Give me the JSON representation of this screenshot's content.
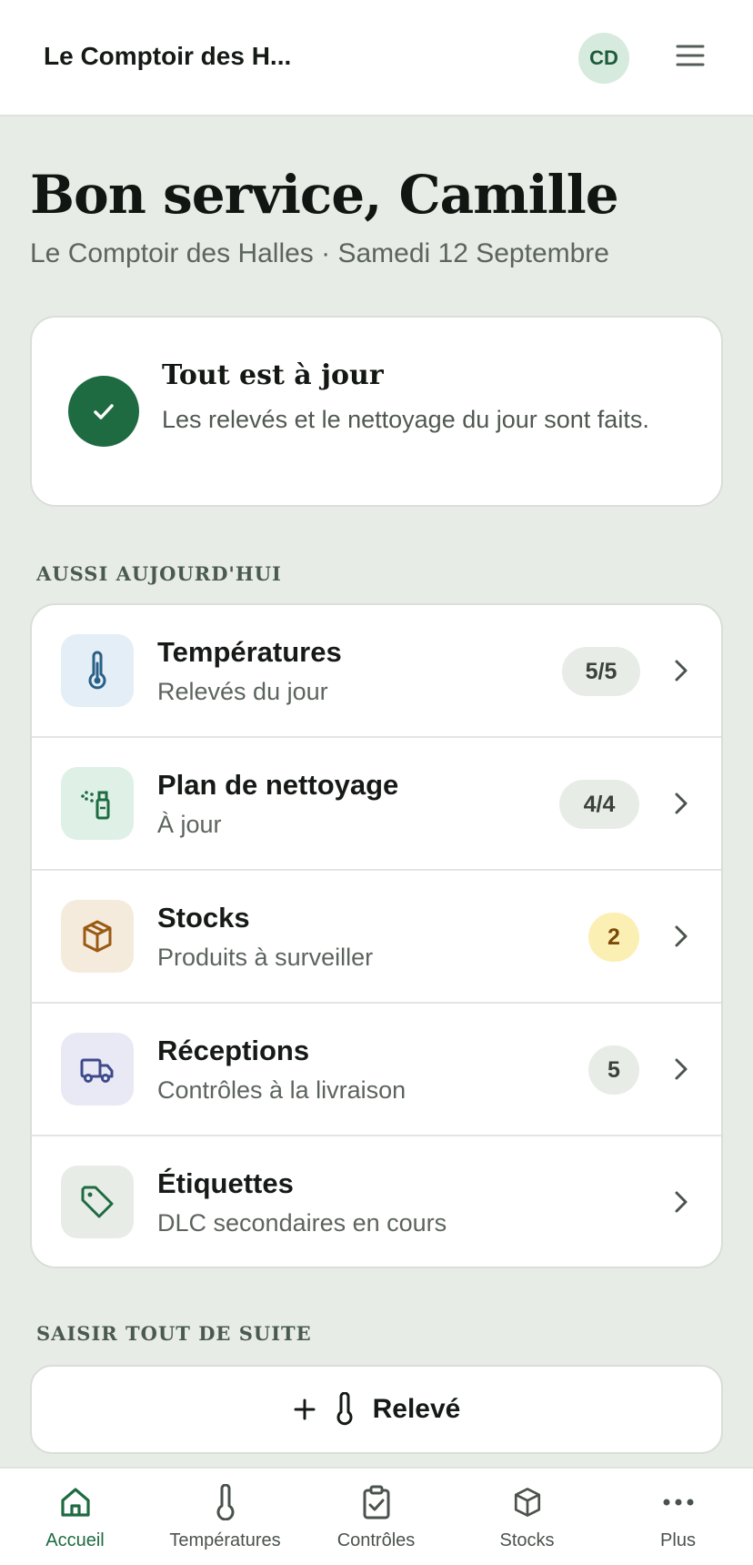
{
  "header": {
    "app_name": "Le Comptoir des H...",
    "avatar_initials": "CD"
  },
  "greeting": {
    "title": "Bon service, Camille",
    "subtitle": "Le Comptoir des Halles · Samedi 12 Septembre"
  },
  "status": {
    "title": "Tout est à jour",
    "description": "Les relevés et le nettoyage du jour sont faits."
  },
  "today": {
    "section_label": "AUSSI AUJOURD'HUI",
    "items": [
      {
        "title": "Températures",
        "subtitle": "Relevés du jour",
        "badge": "5/5",
        "icon": "thermometer-icon"
      },
      {
        "title": "Plan de nettoyage",
        "subtitle": "À jour",
        "badge": "4/4",
        "icon": "spray-bottle-icon"
      },
      {
        "title": "Stocks",
        "subtitle": "Produits à surveiller",
        "badge": "2",
        "icon": "box-icon"
      },
      {
        "title": "Réceptions",
        "subtitle": "Contrôles à la livraison",
        "badge": "5",
        "icon": "truck-icon"
      },
      {
        "title": "Étiquettes",
        "subtitle": "DLC secondaires en cours",
        "badge": "",
        "icon": "tag-icon"
      }
    ]
  },
  "quick_entry": {
    "section_label": "SAISIR TOUT DE SUITE",
    "action_label": "Relevé"
  },
  "nav": {
    "items": [
      {
        "label": "Accueil",
        "icon": "home-icon",
        "active": true
      },
      {
        "label": "Températures",
        "icon": "thermometer-icon"
      },
      {
        "label": "Contrôles",
        "icon": "clipboard-check-icon"
      },
      {
        "label": "Stocks",
        "icon": "box-icon"
      },
      {
        "label": "Plus",
        "icon": "more-icon"
      }
    ]
  },
  "colors": {
    "accent": "#1e6b42",
    "background": "#e8ece7",
    "warn_badge": "#fcefb4"
  }
}
